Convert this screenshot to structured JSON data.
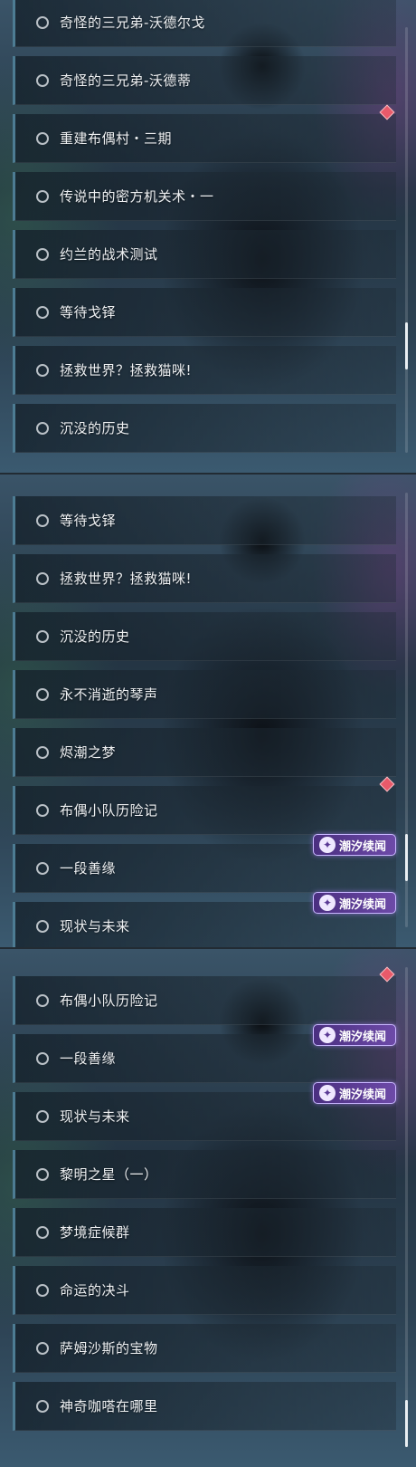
{
  "panels": [
    {
      "items": [
        {
          "label": "奇怪的三兄弟-沃德尔戈"
        },
        {
          "label": "奇怪的三兄弟-沃德蒂"
        },
        {
          "label": "重建布偶村・三期",
          "marker": true
        },
        {
          "label": "传说中的密方机关术・一"
        },
        {
          "label": "约兰的战术测试"
        },
        {
          "label": "等待戈铎"
        },
        {
          "label": "拯救世界？拯救猫咪!"
        },
        {
          "label": "沉没的历史"
        }
      ],
      "scroll_position": 0.78
    },
    {
      "items": [
        {
          "label": "等待戈铎"
        },
        {
          "label": "拯救世界？拯救猫咪!"
        },
        {
          "label": "沉没的历史"
        },
        {
          "label": "永不消逝的琴声"
        },
        {
          "label": "烬潮之梦"
        },
        {
          "label": "布偶小队历险记",
          "marker": true
        },
        {
          "label": "一段善缘",
          "tag": "潮汐续闻"
        },
        {
          "label": "现状与未来",
          "tag": "潮汐续闻"
        }
      ],
      "scroll_position": 0.88
    },
    {
      "items": [
        {
          "label": "布偶小队历险记",
          "marker": true
        },
        {
          "label": "一段善缘",
          "tag": "潮汐续闻"
        },
        {
          "label": "现状与未来",
          "tag": "潮汐续闻"
        },
        {
          "label": "黎明之星（一）"
        },
        {
          "label": "梦境症候群"
        },
        {
          "label": "命运的决斗"
        },
        {
          "label": "萨姆沙斯的宝物"
        },
        {
          "label": "神奇咖嗒在哪里"
        }
      ],
      "scroll_position": 1.0
    }
  ],
  "colors": {
    "accent_bar": "#4d7c93",
    "marker": "#e85a6a",
    "tag_bg": "#5a3a95"
  },
  "icons": {
    "radio": "radio-circle-icon",
    "marker": "red-diamond-icon",
    "tag": "tide-emblem-icon"
  }
}
